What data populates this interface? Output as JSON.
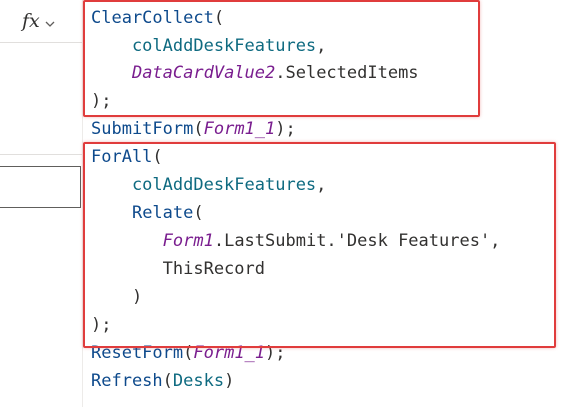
{
  "formula_bar": {
    "fx_label": "fx",
    "dropdown_icon": "chevron-down-icon"
  },
  "editor": {
    "lines": [
      [
        {
          "t": "ClearCollect",
          "k": "fn"
        },
        {
          "t": "(",
          "k": "plain"
        }
      ],
      [
        {
          "t": "    colAddDeskFeatures",
          "k": "var"
        },
        {
          "t": ",",
          "k": "plain"
        }
      ],
      [
        {
          "t": "    ",
          "k": "plain"
        },
        {
          "t": "DataCardValue2",
          "k": "ctl"
        },
        {
          "t": ".SelectedItems",
          "k": "plain"
        }
      ],
      [
        {
          "t": ");",
          "k": "plain"
        }
      ],
      [
        {
          "t": "SubmitForm",
          "k": "fn"
        },
        {
          "t": "(",
          "k": "plain"
        },
        {
          "t": "Form1_1",
          "k": "ctl"
        },
        {
          "t": ");",
          "k": "plain"
        }
      ],
      [
        {
          "t": "ForAll",
          "k": "fn"
        },
        {
          "t": "(",
          "k": "plain"
        }
      ],
      [
        {
          "t": "    colAddDeskFeatures",
          "k": "var"
        },
        {
          "t": ",",
          "k": "plain"
        }
      ],
      [
        {
          "t": "    ",
          "k": "plain"
        },
        {
          "t": "Relate",
          "k": "fn"
        },
        {
          "t": "(",
          "k": "plain"
        }
      ],
      [
        {
          "t": "       ",
          "k": "plain"
        },
        {
          "t": "Form1",
          "k": "ctl"
        },
        {
          "t": ".LastSubmit.'Desk Features',",
          "k": "plain"
        }
      ],
      [
        {
          "t": "       ThisRecord",
          "k": "plain"
        }
      ],
      [
        {
          "t": "    )",
          "k": "plain"
        }
      ],
      [
        {
          "t": ");",
          "k": "plain"
        }
      ],
      [
        {
          "t": "ResetForm",
          "k": "fn"
        },
        {
          "t": "(",
          "k": "plain"
        },
        {
          "t": "Form1_1",
          "k": "ctl"
        },
        {
          "t": ");",
          "k": "plain"
        }
      ],
      [
        {
          "t": "Refresh",
          "k": "fn"
        },
        {
          "t": "(",
          "k": "plain"
        },
        {
          "t": "Desks",
          "k": "var"
        },
        {
          "t": ")",
          "k": "plain"
        }
      ]
    ]
  },
  "colors": {
    "highlight": "#e03c3c",
    "function": "#0e4a8c",
    "variable": "#0e6a80",
    "control": "#7a1e8f",
    "text": "#323130"
  }
}
